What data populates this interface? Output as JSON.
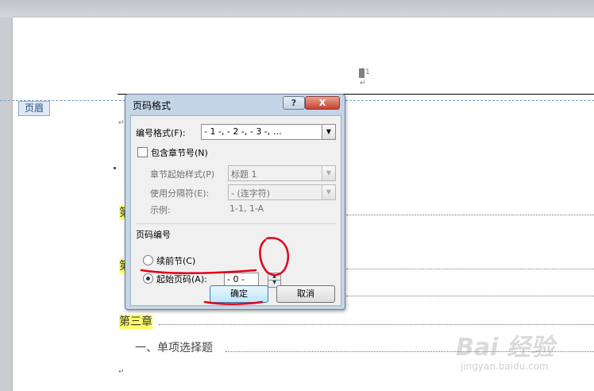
{
  "document": {
    "header_tag": "页眉",
    "header_mark": "1",
    "para_mark": "↵",
    "chapter_prefix_1": "第",
    "chapter_prefix_2": "第",
    "chapter_three": "第三章",
    "section_item": "一、单项选择题"
  },
  "dialog": {
    "title": "页码格式",
    "help_label": "?",
    "close_label": "X",
    "number_format_label": "编号格式(F):",
    "number_format_value": "- 1 -, - 2 -, - 3 -, …",
    "include_chapter_label": "包含章节号(N)",
    "chapter_style_label": "章节起始样式(P)",
    "chapter_style_value": "标题 1",
    "separator_label": "使用分隔符(E):",
    "separator_value": "-  (连字符)",
    "example_label": "示例:",
    "example_value": "1-1, 1-A",
    "page_numbering_label": "页码编号",
    "continue_label": "续前节(C)",
    "start_at_label": "起始页码(A):",
    "start_at_value": "- 0 -",
    "ok_label": "确定",
    "cancel_label": "取消"
  },
  "watermark": {
    "text": "Bai 经验",
    "url": "jingyan.baidu.com"
  },
  "colors": {
    "highlight": "#ffff66",
    "dialog_frame": "#c5d5e8",
    "annotation_red": "#e0001a"
  }
}
